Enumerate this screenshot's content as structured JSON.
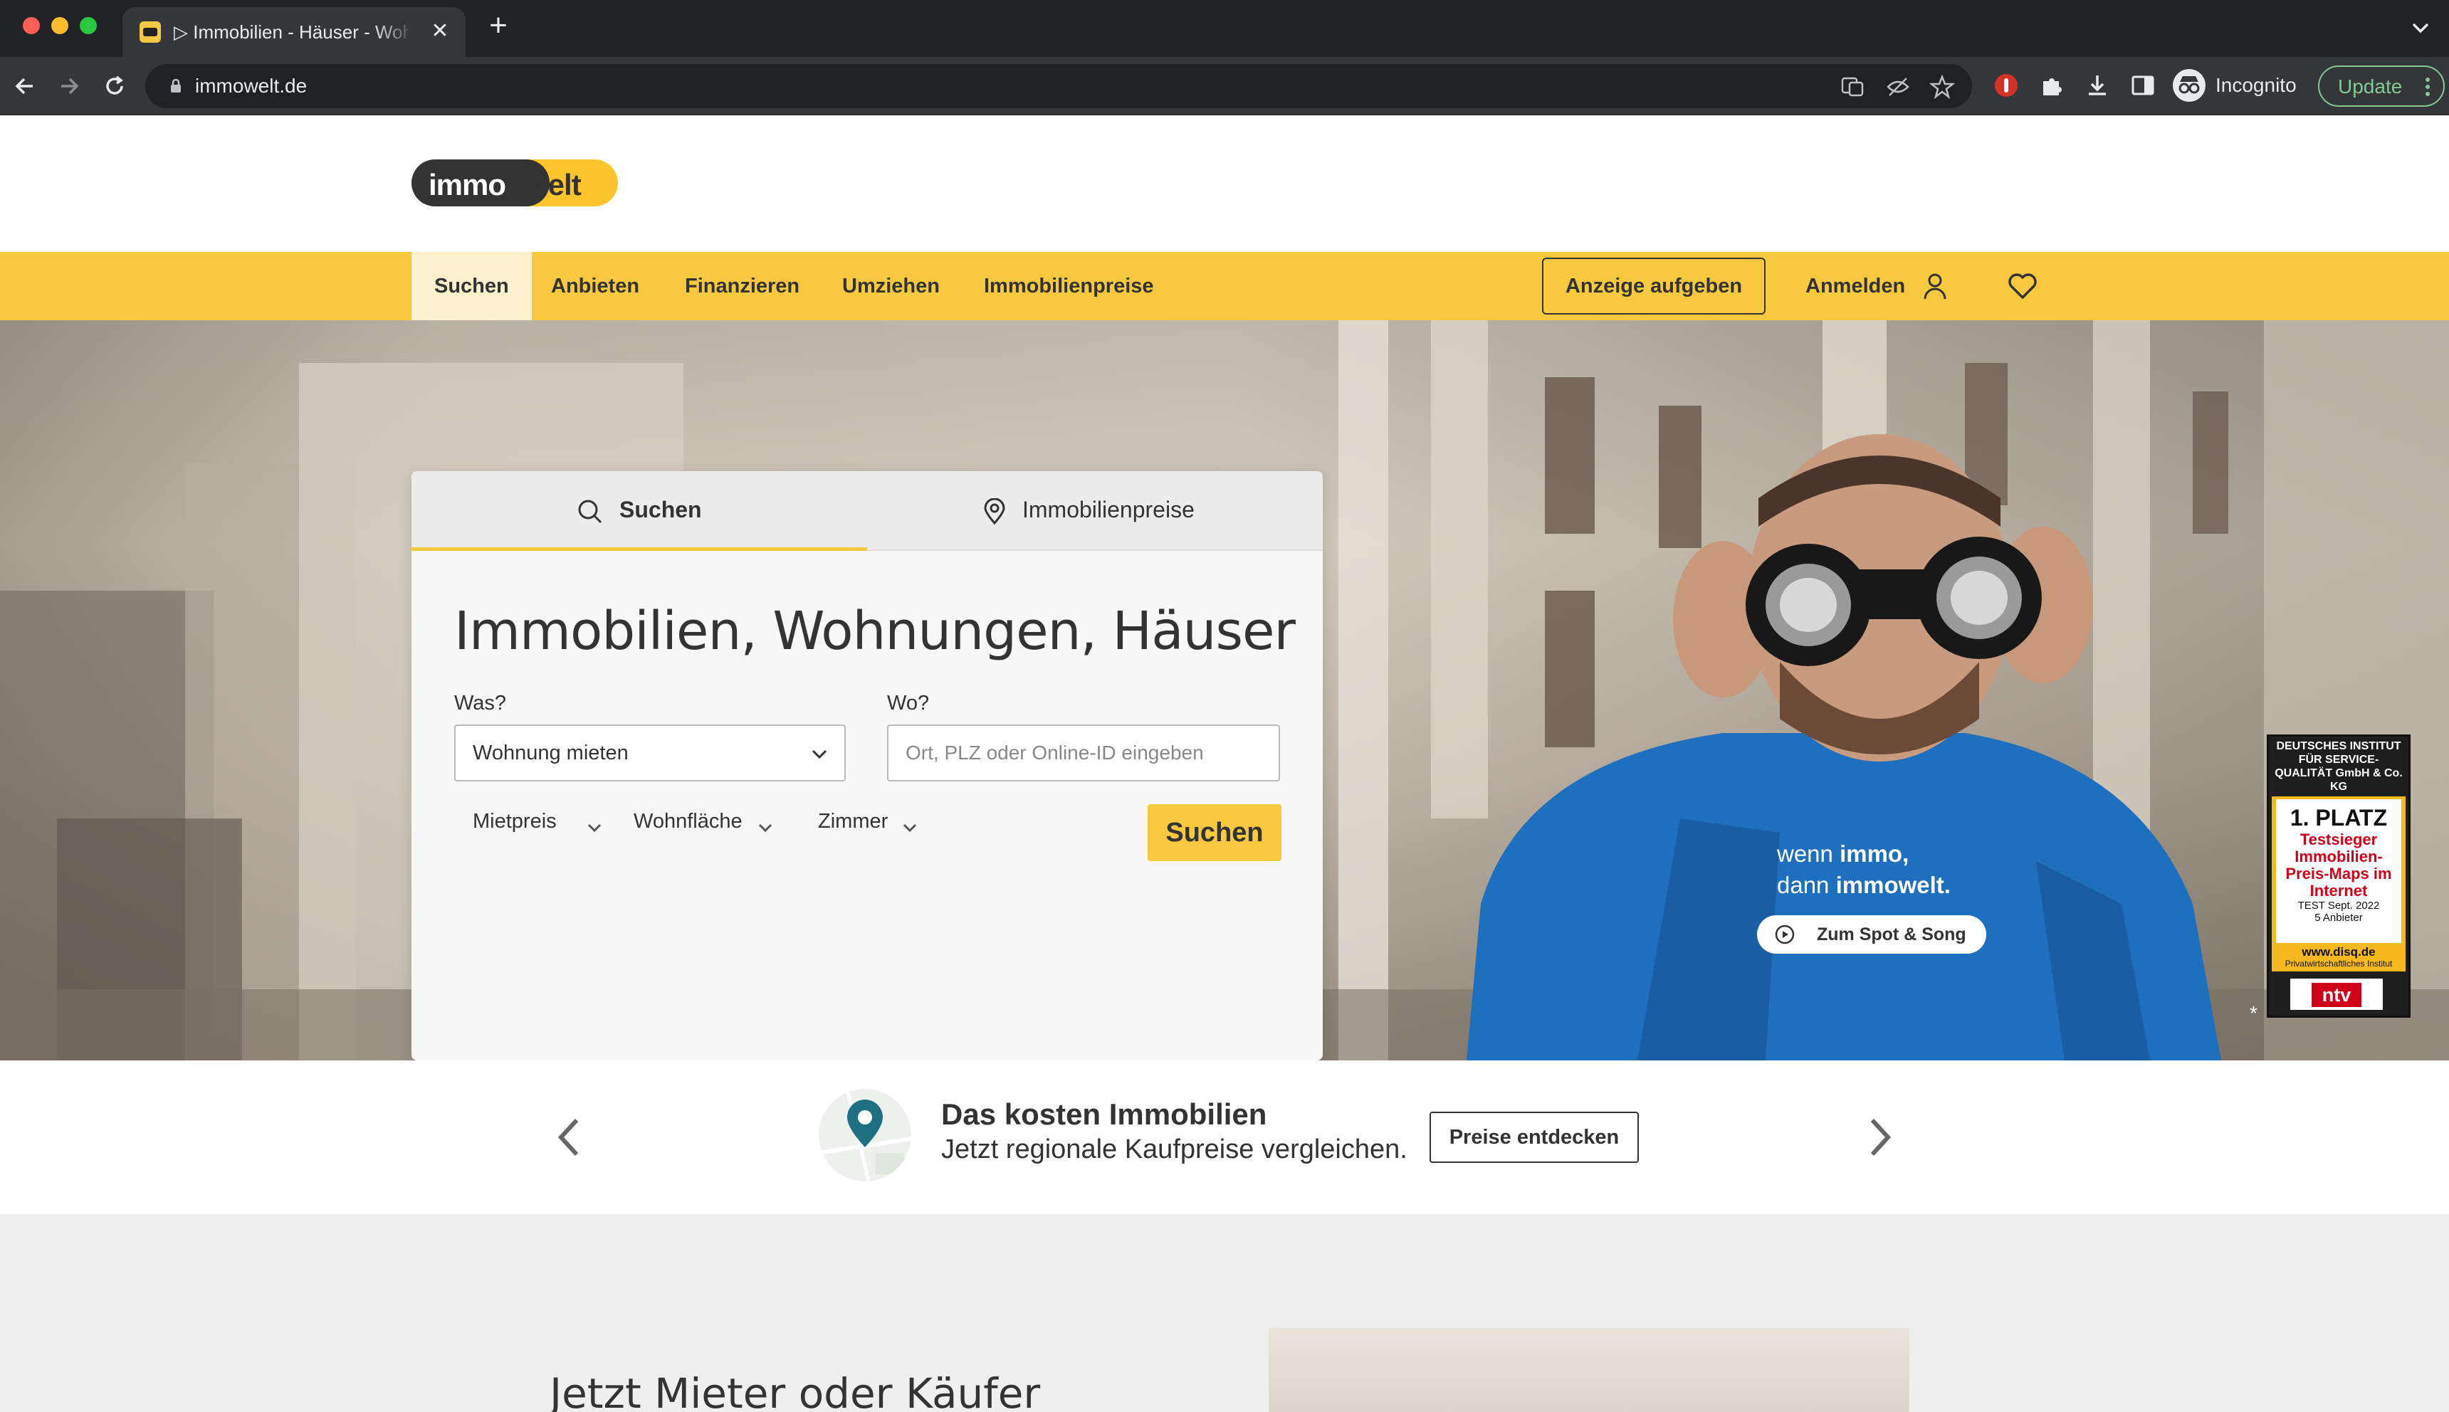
{
  "browser": {
    "tab_title": "▷ Immobilien - Häuser - Wohnungen",
    "tab_close": "✕",
    "new_tab": "+",
    "url": "immowelt.de",
    "incognito_label": "Incognito",
    "update_label": "Update",
    "icons": [
      "back-icon",
      "forward-icon",
      "reload-icon",
      "lock-icon",
      "translate-icon",
      "eye-off-icon",
      "star-icon",
      "extension-shield-icon",
      "puzzle-icon",
      "download-icon",
      "sidepanel-icon",
      "incognito-icon",
      "menu-dots-icon"
    ]
  },
  "site": {
    "logo_immo": "immo",
    "logo_welt": "welt",
    "nav": {
      "items": [
        "Suchen",
        "Anbieten",
        "Finanzieren",
        "Umziehen",
        "Immobilienpreise"
      ],
      "ad_button": "Anzeige aufgeben",
      "login": "Anmelden"
    },
    "colors": {
      "brand_yellow": "#f8c93e",
      "nav_active_bg": "#fdf0cc",
      "text_dark": "#333333"
    }
  },
  "search": {
    "tabs": [
      "Suchen",
      "Immobilienpreise"
    ],
    "title": "Immobilien, Wohnungen, Häuser",
    "was_label": "Was?",
    "was_value": "Wohnung mieten",
    "wo_label": "Wo?",
    "wo_placeholder": "Ort, PLZ oder Online-ID eingeben",
    "filters": [
      "Mietpreis",
      "Wohnfläche",
      "Zimmer"
    ],
    "submit": "Suchen"
  },
  "hero": {
    "tagline_line1_pre": "wenn ",
    "tagline_line1_bold": "immo,",
    "tagline_line2_pre": "dann ",
    "tagline_line2_bold": "immowelt.",
    "spot_button": "Zum Spot & Song",
    "award": {
      "institute": "DEUTSCHES INSTITUT FÜR SERVICE-QUALITÄT GmbH & Co. KG",
      "place": "1. PLATZ",
      "title": "Testsieger Immobilien-Preis-Maps im Internet",
      "test": "TEST Sept. 2022",
      "providers": "5 Anbieter",
      "site": "www.disq.de",
      "site_sub": "Privatwirtschaftliches Institut",
      "partner": "ntv"
    },
    "footnote": "*"
  },
  "teaser": {
    "title": "Das kosten Immobilien",
    "subtitle": "Jetzt regionale Kaufpreise vergleichen.",
    "button": "Preise entdecken"
  },
  "lower": {
    "heading": "Jetzt Mieter oder Käufer"
  }
}
